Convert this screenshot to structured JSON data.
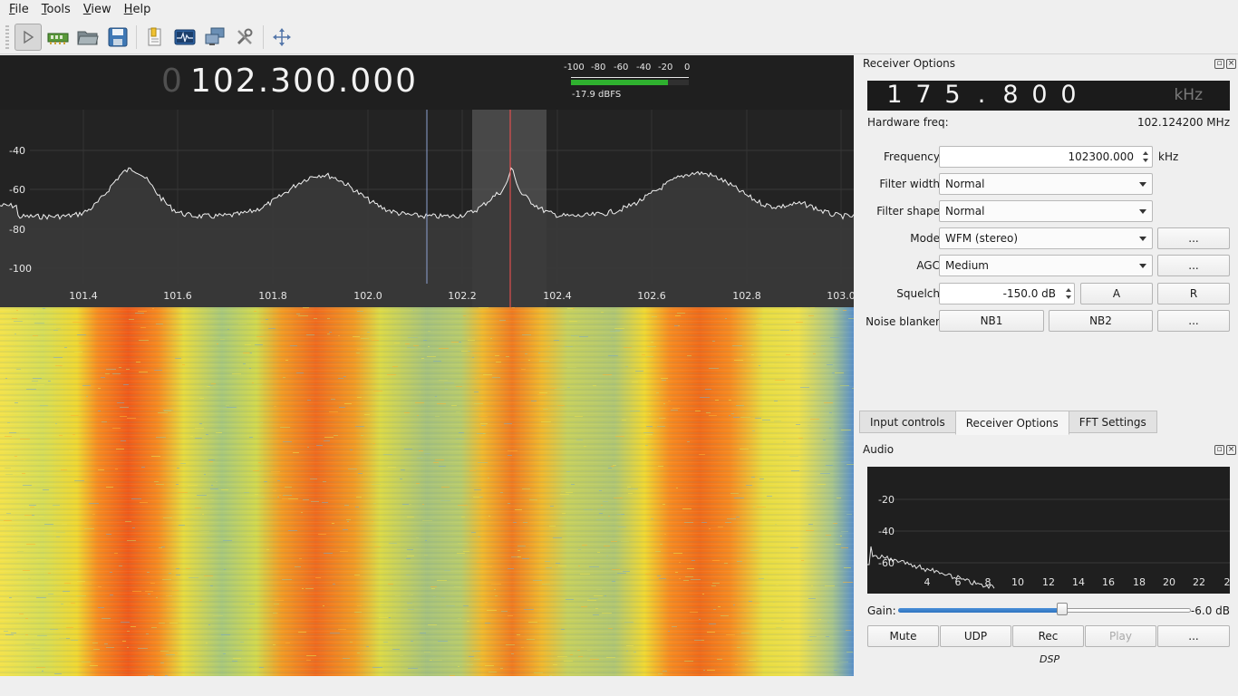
{
  "menu": {
    "items": [
      {
        "u": "F",
        "rest": "ile"
      },
      {
        "u": "T",
        "rest": "ools"
      },
      {
        "u": "V",
        "rest": "iew"
      },
      {
        "u": "H",
        "rest": "elp"
      }
    ]
  },
  "toolbar": {
    "icons": [
      "play-icon",
      "hardware-icon",
      "open-folder-icon",
      "save-icon",
      "bookmark-icon",
      "signal-monitor-icon",
      "network-icon",
      "tools-icon",
      "fullscreen-icon"
    ]
  },
  "main_freq": {
    "dim_digit": "0",
    "value": "102.300.000"
  },
  "signal_meter": {
    "scale": [
      "-100",
      "-80",
      "-60",
      "-40",
      "-20",
      "0"
    ],
    "level_text": "-17.9 dBFS",
    "level_fraction": 0.82,
    "color": "#2fb02f"
  },
  "spectrum": {
    "y_ticks": [
      "-40",
      "-60",
      "-80",
      "-100"
    ],
    "x_ticks": [
      "101.4",
      "101.6",
      "101.8",
      "102.0",
      "102.2",
      "102.4",
      "102.6",
      "102.8",
      "103.0"
    ],
    "demod_marker_color": "#ff5050",
    "hw_marker_color": "#8ea0d0"
  },
  "receiver": {
    "title": "Receiver Options",
    "lcd_digits": [
      "1",
      "7",
      "5",
      ".",
      "8",
      "0",
      "0"
    ],
    "lcd_unit": "kHz",
    "hardware_freq_label": "Hardware freq:",
    "hardware_freq_value": "102.124200 MHz",
    "frequency_label": "Frequency",
    "frequency_value": "102300.000",
    "frequency_unit": "kHz",
    "filter_width_label": "Filter width",
    "filter_width_value": "Normal",
    "filter_shape_label": "Filter shape",
    "filter_shape_value": "Normal",
    "mode_label": "Mode",
    "mode_value": "WFM (stereo)",
    "mode_more": "...",
    "agc_label": "AGC",
    "agc_value": "Medium",
    "agc_more": "...",
    "squelch_label": "Squelch",
    "squelch_value": "-150.0 dB",
    "squelch_a": "A",
    "squelch_r": "R",
    "noise_blanker_label": "Noise blanker",
    "nb1": "NB1",
    "nb2": "NB2",
    "nb_more": "..."
  },
  "tabs": [
    "Input controls",
    "Receiver Options",
    "FFT Settings"
  ],
  "audio": {
    "title": "Audio",
    "y_ticks": [
      "-20",
      "-40",
      "-60"
    ],
    "x_ticks": [
      "4",
      "6",
      "8",
      "10",
      "12",
      "14",
      "16",
      "18",
      "20",
      "22",
      "2"
    ],
    "gain_label": "Gain:",
    "gain_value": "-6.0 dB",
    "gain_fraction": 0.56,
    "buttons": {
      "mute": "Mute",
      "udp": "UDP",
      "rec": "Rec",
      "play": "Play",
      "more": "..."
    },
    "dsp_label": "DSP"
  }
}
